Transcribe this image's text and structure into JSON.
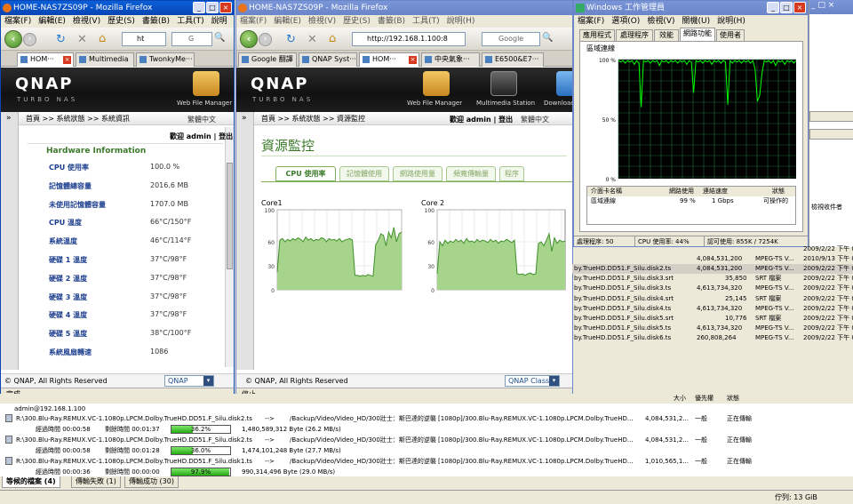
{
  "win1": {
    "title": "HOME-NAS7ZS09P - Mozilla Firefox",
    "menu": [
      "檔案(F)",
      "編輯(E)",
      "檢視(V)",
      "歷史(S)",
      "書籤(B)",
      "工具(T)",
      "說明"
    ],
    "url": "ht",
    "search": "G",
    "tabs": [
      "HOM···",
      "Multimedia",
      "TwonkyMe···"
    ],
    "qnap": {
      "logo": "QNAP",
      "sub": "TURBO NAS",
      "app": "Web File Manager"
    },
    "breadcrumb": "首頁 >> 系統狀態 >> 系統資訊",
    "lang": "繁體中文",
    "welcome": "歡迎 admin | 登出",
    "hw_title": "Hardware Information",
    "hw": [
      {
        "k": "CPU 使用率",
        "v": "100.0 %"
      },
      {
        "k": "記憶體總容量",
        "v": "2016.6 MB"
      },
      {
        "k": "未使用記憶體容量",
        "v": "1707.0 MB"
      },
      {
        "k": "CPU 溫度",
        "v": "66°C/150°F"
      },
      {
        "k": "系統溫度",
        "v": "46°C/114°F"
      },
      {
        "k": "硬碟 1 溫度",
        "v": "37°C/98°F"
      },
      {
        "k": "硬碟 2 溫度",
        "v": "37°C/98°F"
      },
      {
        "k": "硬碟 3 溫度",
        "v": "37°C/98°F"
      },
      {
        "k": "硬碟 4 溫度",
        "v": "37°C/98°F"
      },
      {
        "k": "硬碟 5 溫度",
        "v": "38°C/100°F"
      },
      {
        "k": "系統風扇轉速",
        "v": "1086"
      }
    ],
    "copyright": "© QNAP, All Rights Reserved",
    "theme": "QNAP Classic",
    "status": "完成"
  },
  "win2": {
    "title": "HOME-NAS7ZS09P - Mozilla Firefox",
    "menu": [
      "檔案(F)",
      "編輯(E)",
      "檢視(V)",
      "歷史(S)",
      "書籤(B)",
      "工具(T)",
      "說明(H)"
    ],
    "url": "http://192.168.1.100:8",
    "search": "Google",
    "tabs": [
      "Google 翻譯",
      "QNAP Syst···",
      "HOM···",
      "中央氣象···",
      "E6500&E7···"
    ],
    "qnap": {
      "logo": "QNAP",
      "sub": "TURBO NAS",
      "apps": [
        "Web File Manager",
        "Multimedia Station",
        "Download"
      ]
    },
    "breadcrumb": "首頁 >> 系統狀態 >> 資源監控",
    "welcome": "歡迎 admin | 登出",
    "lang": "繁體中文",
    "page_title": "資源監控",
    "mtabs": [
      "CPU 使用率",
      "記憶體使用",
      "網路使用量",
      "頻寬傳輸量",
      "程序"
    ],
    "copyright": "© QNAP, All Rights Reserved",
    "theme": "QNAP Classic",
    "status": "停止"
  },
  "chart_data": [
    {
      "type": "area",
      "title": "Core1",
      "ylim": [
        0,
        100
      ],
      "yticks": [
        "100",
        "60",
        "30",
        "0"
      ],
      "color": "#6ab04c",
      "values": [
        22,
        62,
        64,
        60,
        63,
        61,
        64,
        62,
        65,
        63,
        60,
        66,
        62,
        64,
        61,
        63,
        62,
        65,
        64,
        60,
        64,
        62,
        63,
        61,
        64,
        60,
        62,
        63,
        64,
        62,
        18,
        18,
        17,
        18,
        17,
        19,
        18,
        17,
        56,
        62,
        70,
        68,
        55,
        72,
        65,
        78,
        60,
        70,
        72
      ]
    },
    {
      "type": "area",
      "title": "Core 2",
      "ylim": [
        0,
        100
      ],
      "yticks": [
        "100",
        "60",
        "30",
        "0"
      ],
      "color": "#6ab04c",
      "values": [
        20,
        60,
        55,
        62,
        58,
        61,
        59,
        63,
        60,
        62,
        58,
        64,
        60,
        61,
        59,
        63,
        60,
        62,
        61,
        59,
        63,
        60,
        62,
        58,
        61,
        60,
        63,
        61,
        59,
        62,
        20,
        19,
        20,
        18,
        20,
        21,
        19,
        20,
        58,
        60,
        55,
        62,
        70,
        48,
        65,
        58,
        62,
        60,
        61
      ]
    },
    {
      "type": "line",
      "title": "區域連線",
      "ylim": [
        0,
        100
      ],
      "yticks": [
        "100 %",
        "50 %",
        "0 %"
      ],
      "color": "#00ff00",
      "values": [
        99,
        98,
        99,
        97,
        99,
        98,
        99,
        96,
        99,
        97,
        60,
        99,
        98,
        99,
        97,
        99,
        98,
        99,
        95,
        99,
        98,
        99,
        97,
        99,
        98,
        99,
        97,
        99,
        98,
        99,
        96,
        99,
        98,
        72,
        99,
        98,
        99,
        97,
        99,
        98,
        99,
        96,
        99,
        98,
        99,
        97,
        99,
        98,
        62,
        99,
        97,
        99,
        98,
        99,
        97,
        99,
        98,
        99,
        97,
        99,
        92,
        65,
        70,
        88,
        99,
        98,
        99,
        97,
        99,
        95,
        99,
        98,
        99,
        96,
        99,
        98,
        99,
        97,
        99
      ]
    }
  ],
  "taskmgr": {
    "title": "Windows 工作管理員",
    "menu": [
      "檔案(F)",
      "選項(O)",
      "檢視(V)",
      "關機(U)",
      "說明(H)"
    ],
    "tabs": [
      "應用程式",
      "處理程序",
      "效能",
      "網路功能",
      "使用者"
    ],
    "graph_label": "區域連線",
    "cols": [
      "介面卡名稱",
      "網路使用",
      "連結速度",
      "狀態"
    ],
    "row": [
      "區域連線",
      "99 %",
      "1 Gbps",
      "可操作的"
    ],
    "status": [
      "處理程序: 50",
      "CPU 使用率: 44%",
      "認可使用: 855K / 7254K"
    ]
  },
  "right_panel": {
    "header": "檢視收件者",
    "rows": [
      {
        "name": "by.TrueHD.DD51.F_Silu.disk2.ts",
        "size": "4,084,531,200",
        "type": "MPEG-TS V...",
        "date": "2009/2/22 下午 0"
      },
      {
        "name": "by.TrueHD.DD51.F_Silu.disk3.srt",
        "size": "35,850",
        "type": "SRT 檔案",
        "date": "2009/2/22 下午 0"
      },
      {
        "name": "by.TrueHD.DD51.F_Silu.disk3.ts",
        "size": "4,613,734,320",
        "type": "MPEG-TS V...",
        "date": "2009/2/22 下午 0"
      },
      {
        "name": "by.TrueHD.DD51.F_Silu.disk4.srt",
        "size": "25,145",
        "type": "SRT 檔案",
        "date": "2009/2/22 下午 0"
      },
      {
        "name": "by.TrueHD.DD51.F_Silu.disk4.ts",
        "size": "4,613,734,320",
        "type": "MPEG-TS V...",
        "date": "2009/2/22 下午 0"
      },
      {
        "name": "by.TrueHD.DD51.F_Silu.disk5.srt",
        "size": "10,776",
        "type": "SRT 檔案",
        "date": "2009/2/22 下午 0"
      },
      {
        "name": "by.TrueHD.DD51.F_Silu.disk5.ts",
        "size": "4,613,734,320",
        "type": "MPEG-TS V...",
        "date": "2009/2/22 下午 0"
      },
      {
        "name": "by.TrueHD.DD51.F_Silu.disk6.ts",
        "size": "260,808,264",
        "type": "MPEG-TS V...",
        "date": "2009/2/22 下午 0"
      }
    ],
    "top_row": {
      "size": "4,084,531,200",
      "type": "MPEG-TS V...",
      "date": "2010/9/13 下午 0"
    },
    "top_row2": {
      "date": "2009/2/22 下午 0"
    }
  },
  "queue": {
    "header": [
      "大小",
      "優先權",
      "狀態"
    ],
    "server": "admin@192.168.1.100",
    "items": [
      {
        "src": "R:\\300.Blu-Ray.REMUX.VC-1.1080p.LPCM.Dolby.TrueHD.DD51.F_Silu.disk2.ts",
        "arrow": "-->",
        "dst": "/Backup/Video/Video_HD/300壯士：斯巴達的逆襲 [1080p]/300.Blu-Ray.REMUX.VC-1.1080p.LPCM.Dolby.TrueHD...",
        "size": "4,084,531,2...",
        "prio": "一般",
        "state": "正在傳輸",
        "elapsed": "經過時間 00:00:58",
        "remain": "剩餘時間 00:01:37",
        "pct": 36.2,
        "pct_label": "36.2%",
        "bytes": "1,480,589,312 Byte (26.2 MB/s)"
      },
      {
        "src": "R:\\300.Blu-Ray.REMUX.VC-1.1080p.LPCM.Dolby.TrueHD.DD51.F_Silu.disk2.ts",
        "arrow": "-->",
        "dst": "/Backup/Video/Video_HD/300壯士：斯巴達的逆襲 [1080p]/300.Blu-Ray.REMUX.VC-1.1080p.LPCM.Dolby.TrueHD...",
        "size": "4,084,531,2...",
        "prio": "一般",
        "state": "正在傳輸",
        "elapsed": "經過時間 00:00:58",
        "remain": "剩餘時間 00:01:28",
        "pct": 36.0,
        "pct_label": "36.0%",
        "bytes": "1,474,101,248 Byte (27.7 MB/s)"
      },
      {
        "src": "R:\\300.Blu-Ray.REMUX.VC-1.1080p.LPCM.Dolby.TrueHD.DD51.F_Silu.disk1.ts",
        "arrow": "-->",
        "dst": "/Backup/Video/Video_HD/300壯士：斯巴達的逆襲 [1080p]/300.Blu-Ray.REMUX.VC-1.1080p.LPCM.Dolby.TrueHD...",
        "size": "1,010,565,1...",
        "prio": "一般",
        "state": "正在傳輸",
        "elapsed": "經過時間 00:00:36",
        "remain": "剩餘時間 00:00:00",
        "pct": 97.9,
        "pct_label": "97.9%",
        "bytes": "990,314,496 Byte (29.0 MB/s)"
      }
    ],
    "tabs": [
      "等候的檔案 (4)",
      "傳輸失敗 (1)",
      "傳輸成功 (30)"
    ],
    "queue_label": "佇列: 13 GiB"
  }
}
